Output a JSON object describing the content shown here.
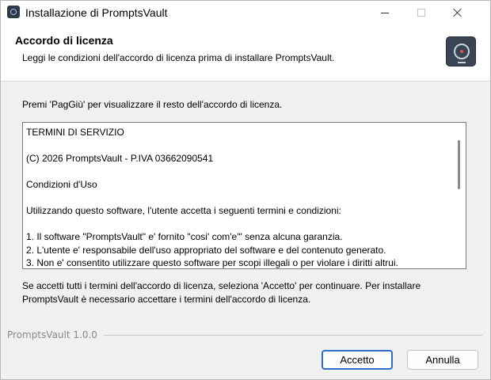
{
  "window": {
    "title": "Installazione di PromptsVault"
  },
  "header": {
    "title": "Accordo di licenza",
    "subtitle": "Leggi le condizioni dell'accordo di licenza prima di installare PromptsVault."
  },
  "body": {
    "instruction": "Premi 'PagGiù' per visualizzare il resto dell'accordo di licenza.",
    "license_lines": [
      "TERMINI DI SERVIZIO",
      "(C) 2026 PromptsVault - P.IVA 03662090541",
      "Condizioni d'Uso",
      "Utilizzando questo software, l'utente accetta i seguenti termini e condizioni:",
      "1. Il software \"PromptsVault\" e' fornito \"cosi' com'e'\" senza alcuna garanzia.",
      "2. L'utente e' responsabile dell'uso appropriato del software e del contenuto generato.",
      "3. Non e' consentito utilizzare questo software per scopi illegali o per violare i diritti altrui."
    ],
    "footer_text": "Se accetti tutti i termini dell'accordo di licenza, seleziona 'Accetto' per continuare. Per installare PromptsVault è necessario accettare i termini dell'accordo di licenza."
  },
  "branding": "PromptsVault 1.0.0",
  "buttons": {
    "accept": "Accetto",
    "cancel": "Annulla"
  },
  "colors": {
    "accent": "#2f6ec8",
    "logo_bg": "#3a4452"
  },
  "icons": {
    "app": "vault-icon",
    "header_logo": "vault-logo-icon",
    "minimize": "minimize-icon",
    "maximize": "maximize-icon",
    "close": "close-icon"
  }
}
